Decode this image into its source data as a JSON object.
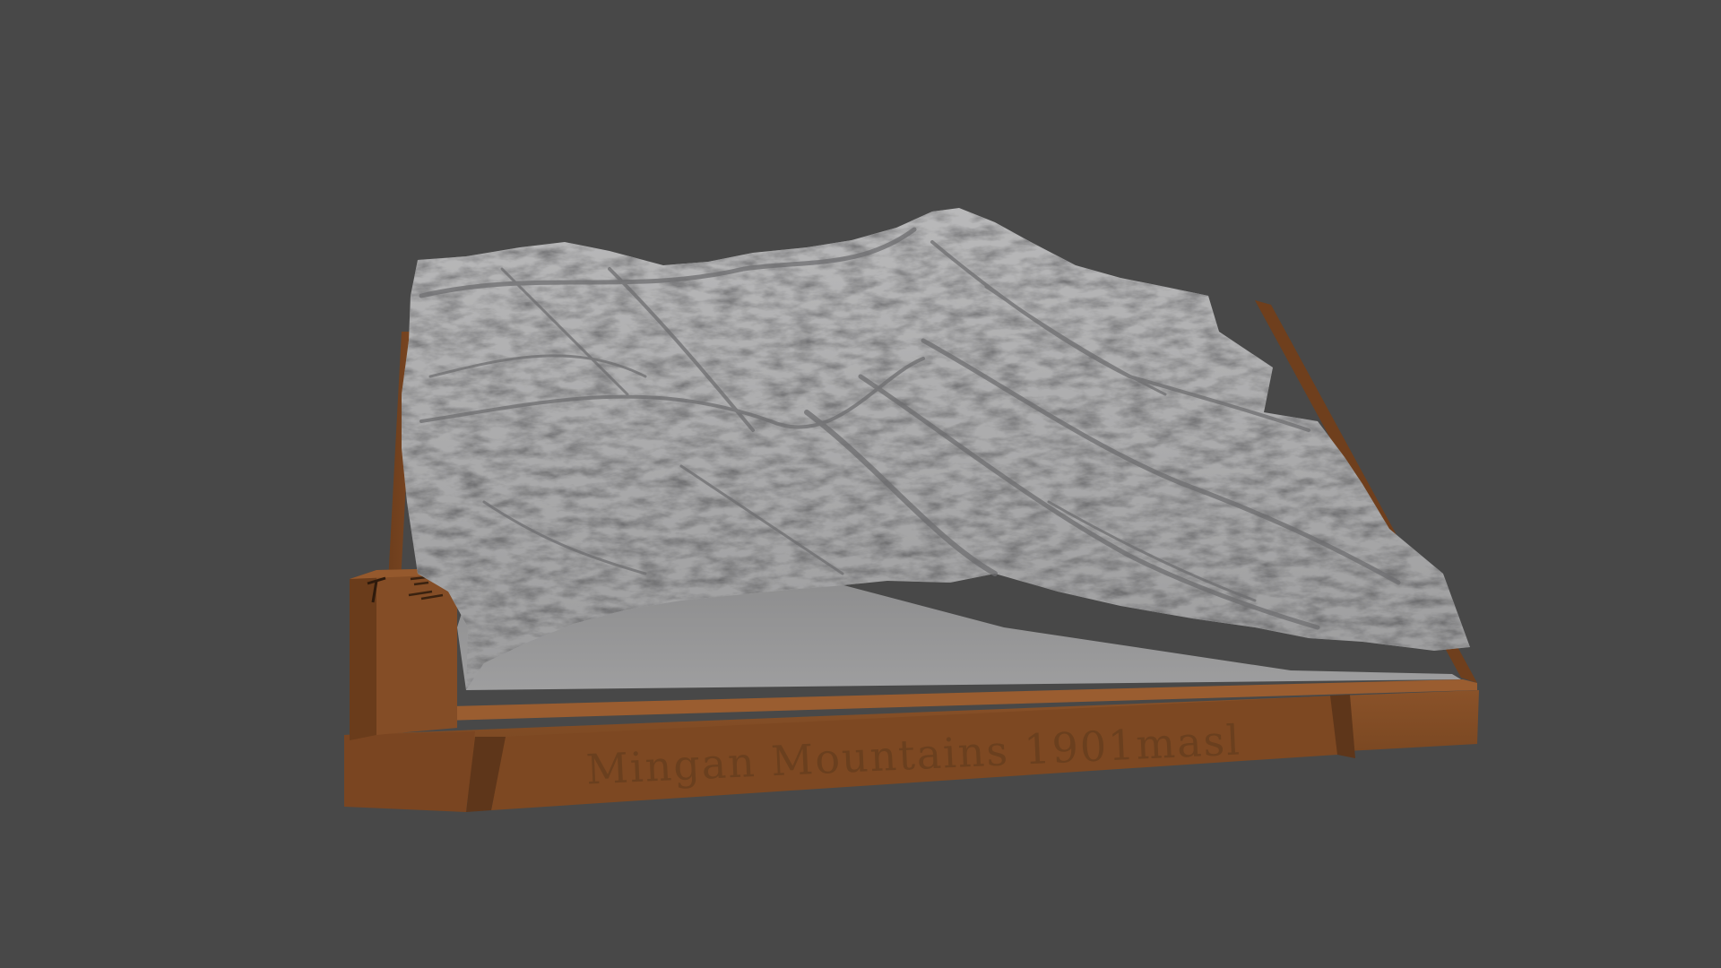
{
  "viewport": {
    "background_color": "#484848"
  },
  "model": {
    "terrain_color": "#a9a9aa",
    "base_color": "#7e4a24",
    "base_label": "Mingan Mountains 1901masl",
    "plaque_icons": [
      "pickaxe-icon",
      "scale-bar-icon"
    ]
  }
}
